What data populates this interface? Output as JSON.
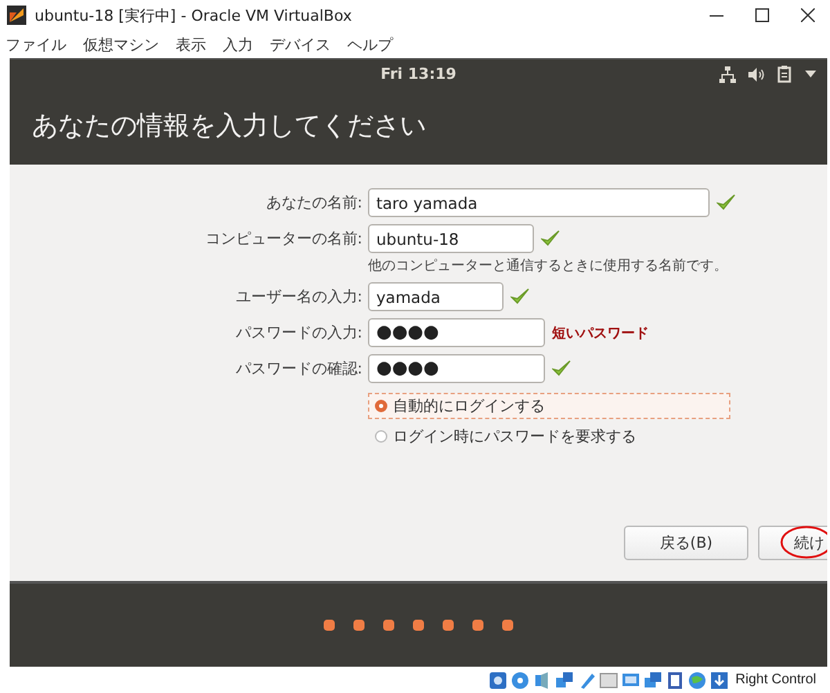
{
  "window": {
    "title": "ubuntu-18 [実行中] - Oracle VM VirtualBox"
  },
  "menu": [
    "ファイル",
    "仮想マシン",
    "表示",
    "入力",
    "デバイス",
    "ヘルプ"
  ],
  "top_panel": {
    "clock": "Fri 13:19"
  },
  "header": {
    "title": "あなたの情報を入力してください"
  },
  "form": {
    "fields": [
      {
        "label": "あなたの名前:",
        "value": "taro yamada",
        "kind": "text",
        "valid": true
      },
      {
        "label": "コンピューターの名前:",
        "value": "ubuntu-18",
        "kind": "text",
        "valid": true,
        "hint": "他のコンピューターと通信するときに使用する名前です。"
      },
      {
        "label": "ユーザー名の入力:",
        "value": "yamada",
        "kind": "text",
        "valid": true
      },
      {
        "label": "パスワードの入力:",
        "value": "●●●●",
        "kind": "password",
        "valid": false,
        "message": "短いパスワード"
      },
      {
        "label": "パスワードの確認:",
        "value": "●●●●",
        "kind": "password",
        "valid": true
      }
    ],
    "login_options": [
      {
        "label": "自動的にログインする",
        "selected": true
      },
      {
        "label": "ログイン時にパスワードを要求する",
        "selected": false
      }
    ]
  },
  "buttons": [
    {
      "label": "戻る(B)",
      "kind": "back"
    },
    {
      "label": "続け",
      "kind": "next",
      "circled": true
    }
  ],
  "status_bar": {
    "host_key": "Right Control"
  }
}
